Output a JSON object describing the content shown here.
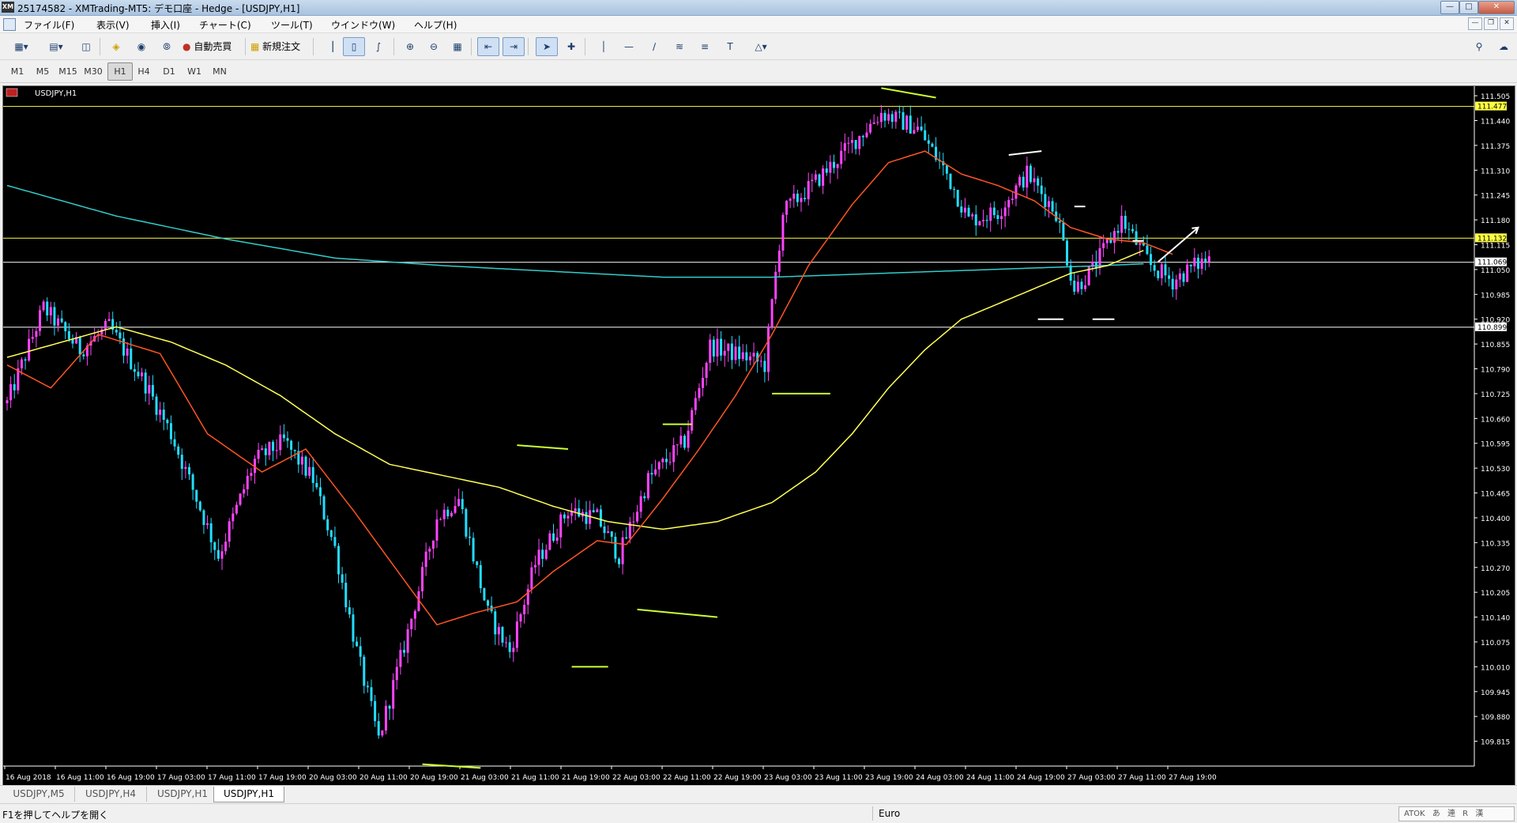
{
  "window": {
    "title": "25174582 - XMTrading-MT5: デモ口座 - Hedge - [USDJPY,H1]",
    "app_icon": "XM"
  },
  "menu": [
    "ファイル(F)",
    "表示(V)",
    "挿入(I)",
    "チャート(C)",
    "ツール(T)",
    "ウインドウ(W)",
    "ヘルプ(H)"
  ],
  "toolbar": {
    "auto_trade_label": "自動売買",
    "new_order_label": "新規注文"
  },
  "timeframes": {
    "items": [
      "M1",
      "M5",
      "M15",
      "M30",
      "H1",
      "H4",
      "D1",
      "W1",
      "MN"
    ],
    "active": "H1"
  },
  "chart_data": {
    "type": "candlestick",
    "symbol_label": "USDJPY,H1",
    "ylim": [
      109.75,
      111.53
    ],
    "y_ticks": [
      111.505,
      111.44,
      111.375,
      111.31,
      111.245,
      111.18,
      111.115,
      111.05,
      110.985,
      110.92,
      110.855,
      110.79,
      110.725,
      110.66,
      110.595,
      110.53,
      110.465,
      110.4,
      110.335,
      110.27,
      110.205,
      110.14,
      110.075,
      110.01,
      109.945,
      109.88,
      109.815
    ],
    "x_labels": [
      "16 Aug 2018",
      "16 Aug 11:00",
      "16 Aug 19:00",
      "17 Aug 03:00",
      "17 Aug 11:00",
      "17 Aug 19:00",
      "20 Aug 03:00",
      "20 Aug 11:00",
      "20 Aug 19:00",
      "21 Aug 03:00",
      "21 Aug 11:00",
      "21 Aug 19:00",
      "22 Aug 03:00",
      "22 Aug 11:00",
      "22 Aug 19:00",
      "23 Aug 03:00",
      "23 Aug 11:00",
      "23 Aug 19:00",
      "24 Aug 03:00",
      "24 Aug 11:00",
      "24 Aug 19:00",
      "27 Aug 03:00",
      "27 Aug 11:00",
      "27 Aug 19:00"
    ],
    "price_levels": [
      {
        "value": 111.477,
        "label": "111.477",
        "color": "#ffff44"
      },
      {
        "value": 111.132,
        "label": "111.132",
        "color": "#ffff44"
      },
      {
        "value": 111.069,
        "label": "111.069",
        "color": "#ffffff"
      },
      {
        "value": 110.899,
        "label": "110.899",
        "color": "#ffffff"
      }
    ],
    "colors": {
      "bull": "#ff44ff",
      "bear": "#22ddff",
      "ma_fast": "#ff5522",
      "ma_mid": "#ffff55",
      "ma_slow": "#33cccc",
      "grid_text": "#ffffff"
    },
    "path_knots": [
      [
        0,
        110.7
      ],
      [
        10,
        110.95
      ],
      [
        20,
        110.84
      ],
      [
        28,
        110.9
      ],
      [
        38,
        110.75
      ],
      [
        45,
        110.62
      ],
      [
        52,
        110.45
      ],
      [
        58,
        110.3
      ],
      [
        68,
        110.55
      ],
      [
        76,
        110.6
      ],
      [
        84,
        110.5
      ],
      [
        90,
        110.32
      ],
      [
        96,
        110.05
      ],
      [
        102,
        109.82
      ],
      [
        110,
        110.1
      ],
      [
        118,
        110.4
      ],
      [
        124,
        110.45
      ],
      [
        132,
        110.15
      ],
      [
        138,
        110.05
      ],
      [
        145,
        110.28
      ],
      [
        154,
        110.42
      ],
      [
        162,
        110.4
      ],
      [
        168,
        110.3
      ],
      [
        176,
        110.5
      ],
      [
        186,
        110.6
      ],
      [
        193,
        110.85
      ],
      [
        203,
        110.82
      ],
      [
        208,
        110.8
      ],
      [
        213,
        111.2
      ],
      [
        222,
        111.28
      ],
      [
        232,
        111.38
      ],
      [
        240,
        111.46
      ],
      [
        250,
        111.42
      ],
      [
        258,
        111.3
      ],
      [
        264,
        111.18
      ],
      [
        272,
        111.2
      ],
      [
        280,
        111.3
      ],
      [
        288,
        111.2
      ],
      [
        293,
        111.0
      ],
      [
        298,
        111.05
      ],
      [
        306,
        111.18
      ],
      [
        314,
        111.06
      ],
      [
        320,
        111.02
      ],
      [
        326,
        111.06
      ],
      [
        330,
        111.08
      ]
    ],
    "ma_fast": [
      [
        0,
        110.8
      ],
      [
        12,
        110.74
      ],
      [
        25,
        110.88
      ],
      [
        42,
        110.83
      ],
      [
        55,
        110.62
      ],
      [
        70,
        110.52
      ],
      [
        82,
        110.58
      ],
      [
        95,
        110.42
      ],
      [
        108,
        110.25
      ],
      [
        118,
        110.12
      ],
      [
        128,
        110.15
      ],
      [
        140,
        110.18
      ],
      [
        150,
        110.26
      ],
      [
        162,
        110.34
      ],
      [
        170,
        110.33
      ],
      [
        180,
        110.45
      ],
      [
        190,
        110.58
      ],
      [
        200,
        110.72
      ],
      [
        210,
        110.88
      ],
      [
        220,
        111.06
      ],
      [
        232,
        111.22
      ],
      [
        242,
        111.33
      ],
      [
        252,
        111.36
      ],
      [
        262,
        111.3
      ],
      [
        272,
        111.27
      ],
      [
        282,
        111.23
      ],
      [
        292,
        111.16
      ],
      [
        302,
        111.13
      ],
      [
        312,
        111.12
      ],
      [
        320,
        111.09
      ]
    ],
    "ma_mid": [
      [
        0,
        110.82
      ],
      [
        15,
        110.86
      ],
      [
        30,
        110.9
      ],
      [
        45,
        110.86
      ],
      [
        60,
        110.8
      ],
      [
        75,
        110.72
      ],
      [
        90,
        110.62
      ],
      [
        105,
        110.54
      ],
      [
        120,
        110.51
      ],
      [
        135,
        110.48
      ],
      [
        150,
        110.43
      ],
      [
        165,
        110.39
      ],
      [
        180,
        110.37
      ],
      [
        195,
        110.39
      ],
      [
        210,
        110.44
      ],
      [
        222,
        110.52
      ],
      [
        232,
        110.62
      ],
      [
        242,
        110.74
      ],
      [
        252,
        110.84
      ],
      [
        262,
        110.92
      ],
      [
        272,
        110.96
      ],
      [
        282,
        111.0
      ],
      [
        292,
        111.04
      ],
      [
        302,
        111.06
      ],
      [
        312,
        111.1
      ]
    ],
    "ma_slow": [
      [
        0,
        111.27
      ],
      [
        30,
        111.19
      ],
      [
        60,
        111.13
      ],
      [
        90,
        111.08
      ],
      [
        120,
        111.06
      ],
      [
        150,
        111.045
      ],
      [
        180,
        111.03
      ],
      [
        210,
        111.03
      ],
      [
        240,
        111.04
      ],
      [
        270,
        111.05
      ],
      [
        300,
        111.06
      ],
      [
        312,
        111.065
      ]
    ],
    "drawings": [
      {
        "type": "line",
        "x1": 240,
        "y1": 111.525,
        "x2": 255,
        "y2": 111.5,
        "color": "#ccff33"
      },
      {
        "type": "line",
        "x1": 275,
        "y1": 111.35,
        "x2": 284,
        "y2": 111.36,
        "color": "#ffffff"
      },
      {
        "type": "line",
        "x1": 293,
        "y1": 111.215,
        "x2": 296,
        "y2": 111.215,
        "color": "#ffffff"
      },
      {
        "type": "line",
        "x1": 309,
        "y1": 111.125,
        "x2": 312,
        "y2": 111.125,
        "color": "#ffffff"
      },
      {
        "type": "line",
        "x1": 283,
        "y1": 110.92,
        "x2": 290,
        "y2": 110.92,
        "color": "#ffffff"
      },
      {
        "type": "line",
        "x1": 298,
        "y1": 110.92,
        "x2": 304,
        "y2": 110.92,
        "color": "#ffffff"
      },
      {
        "type": "line",
        "x1": 210,
        "y1": 110.725,
        "x2": 226,
        "y2": 110.725,
        "color": "#ccff33"
      },
      {
        "type": "line",
        "x1": 180,
        "y1": 110.645,
        "x2": 188,
        "y2": 110.645,
        "color": "#ccff33"
      },
      {
        "type": "line",
        "x1": 140,
        "y1": 110.59,
        "x2": 154,
        "y2": 110.58,
        "color": "#ccff33"
      },
      {
        "type": "line",
        "x1": 173,
        "y1": 110.16,
        "x2": 195,
        "y2": 110.14,
        "color": "#ccff33"
      },
      {
        "type": "line",
        "x1": 155,
        "y1": 110.01,
        "x2": 165,
        "y2": 110.01,
        "color": "#ccff33"
      },
      {
        "type": "line",
        "x1": 114,
        "y1": 109.755,
        "x2": 130,
        "y2": 109.745,
        "color": "#ccff33"
      },
      {
        "type": "arrow",
        "x1": 316,
        "y1": 111.07,
        "x2": 327,
        "y2": 111.16,
        "color": "#ffffff"
      }
    ]
  },
  "tabs": [
    {
      "label": "USDJPY,M5",
      "active": false
    },
    {
      "label": "USDJPY,H4",
      "active": false
    },
    {
      "label": "USDJPY,H1",
      "active": false
    },
    {
      "label": "USDJPY,H1",
      "active": true
    }
  ],
  "status": {
    "help_text": "F1を押してヘルプを開く",
    "profile": "Euro",
    "ime_items": [
      "ATOK",
      "あ",
      "連",
      "R",
      "漢"
    ]
  }
}
